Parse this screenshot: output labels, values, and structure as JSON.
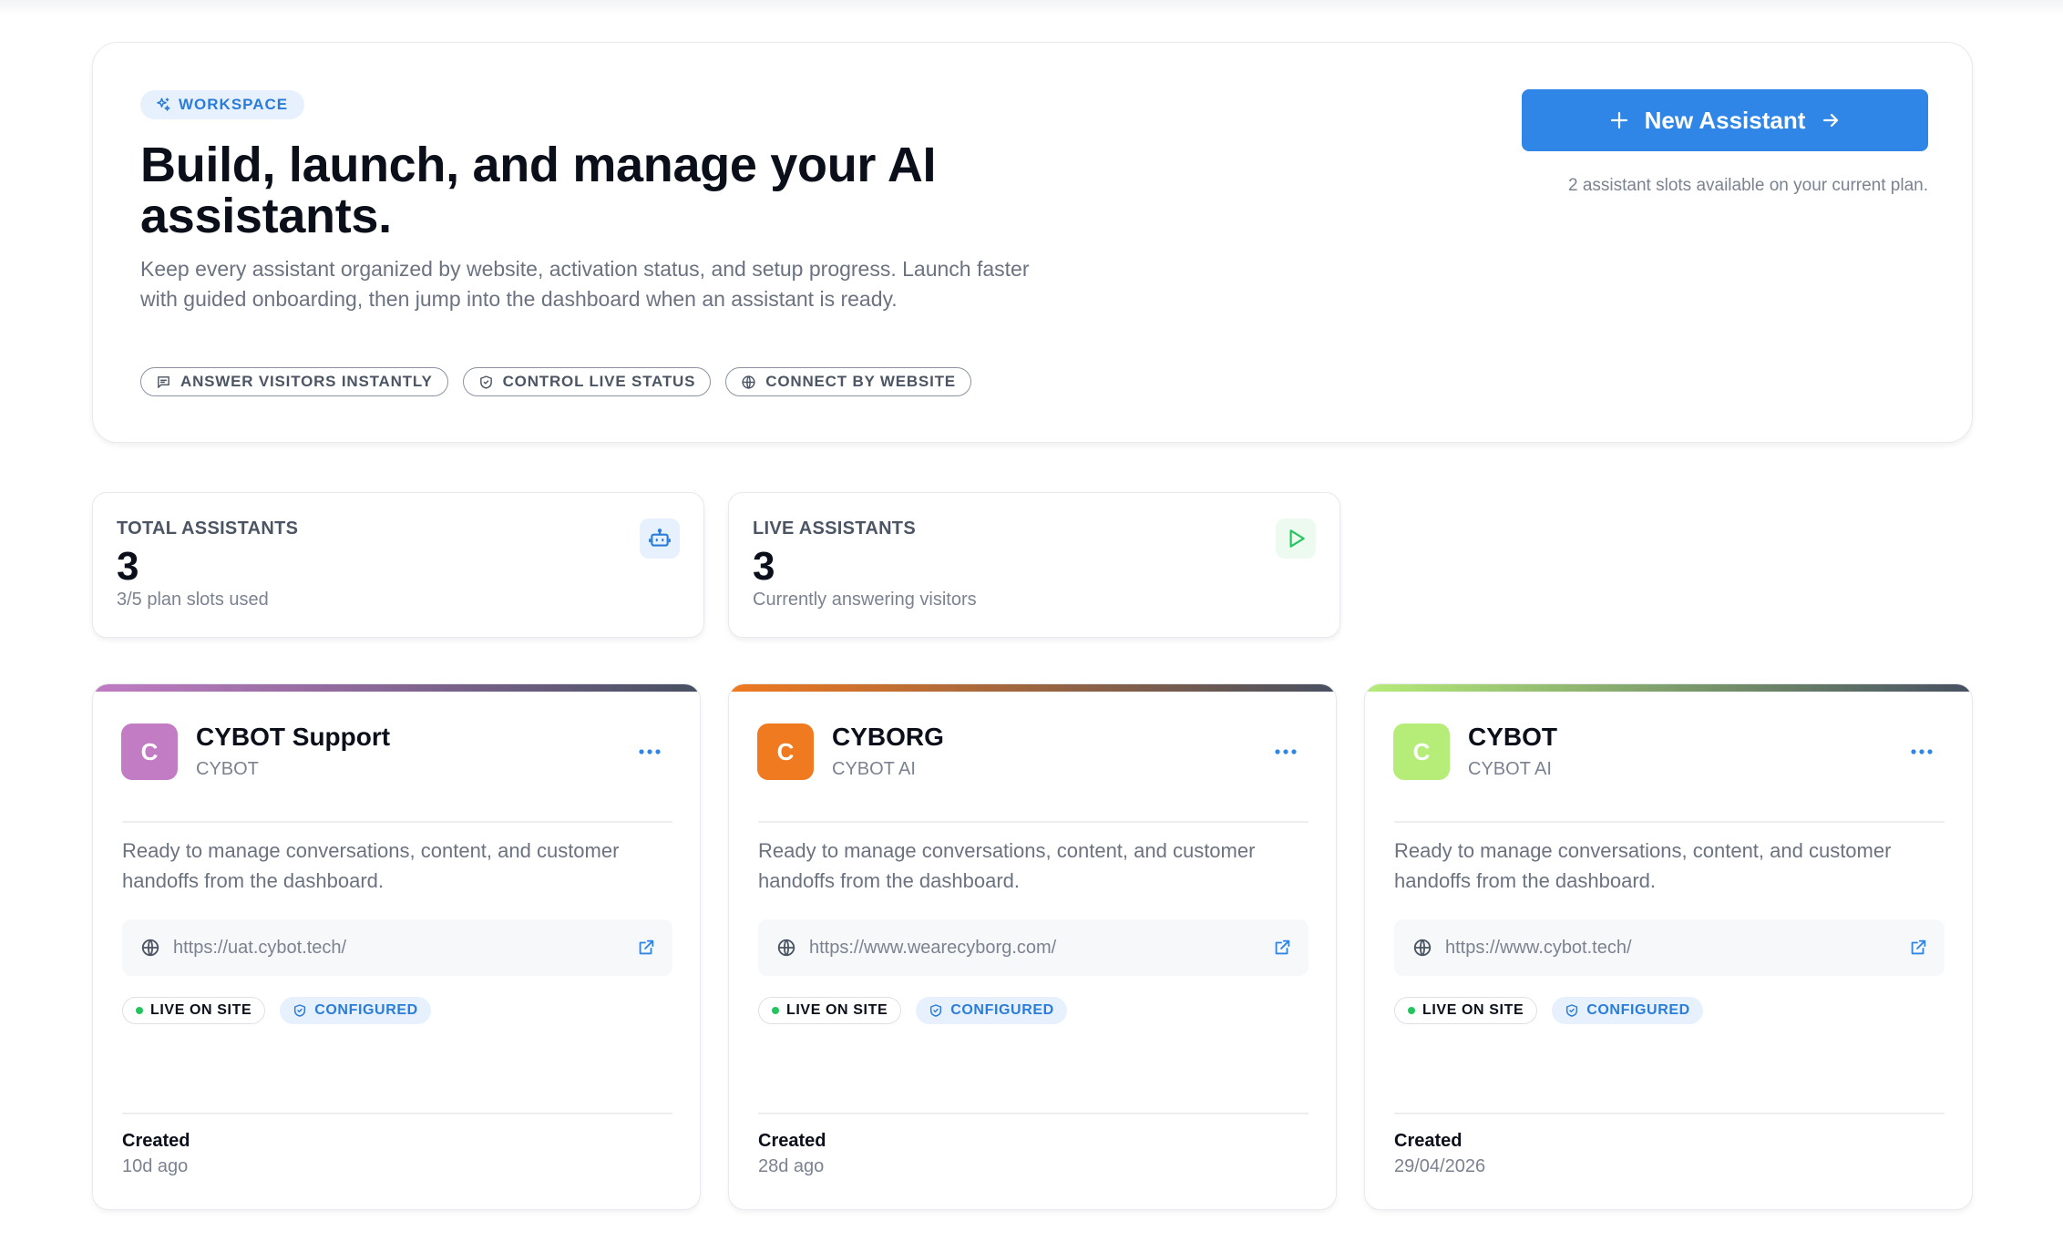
{
  "hero": {
    "badge": "WORKSPACE",
    "title": "Build, launch, and manage your AI assistants.",
    "description": "Keep every assistant organized by website, activation status, and setup progress. Launch faster with guided onboarding, then jump into the dashboard when an assistant is ready.",
    "features": [
      {
        "label": "ANSWER VISITORS INSTANTLY",
        "icon": "message-icon"
      },
      {
        "label": "CONTROL LIVE STATUS",
        "icon": "shield-icon"
      },
      {
        "label": "CONNECT BY WEBSITE",
        "icon": "globe-icon"
      }
    ],
    "new_button_label": "New Assistant",
    "slots_note": "2 assistant slots available on your current plan."
  },
  "stats": {
    "total": {
      "label": "TOTAL ASSISTANTS",
      "value": "3",
      "sub": "3/5 plan slots used",
      "icon": "robot-icon"
    },
    "live": {
      "label": "LIVE ASSISTANTS",
      "value": "3",
      "sub": "Currently answering visitors",
      "icon": "play-icon"
    }
  },
  "assistants": [
    {
      "initial": "C",
      "name": "CYBOT Support",
      "org": "CYBOT",
      "description": "Ready to manage conversations, content, and customer handoffs from the dashboard.",
      "url": "https://uat.cybot.tech/",
      "live_label": "LIVE ON SITE",
      "configured_label": "CONFIGURED",
      "created_label": "Created",
      "created_value": "10d ago",
      "avatar_color": "#c17cc4",
      "bar_gradient": [
        "#c17cc4",
        "#475061"
      ]
    },
    {
      "initial": "C",
      "name": "CYBORG",
      "org": "CYBOT AI",
      "description": "Ready to manage conversations, content, and customer handoffs from the dashboard.",
      "url": "https://www.wearecyborg.com/",
      "live_label": "LIVE ON SITE",
      "configured_label": "CONFIGURED",
      "created_label": "Created",
      "created_value": "28d ago",
      "avatar_color": "#f07a20",
      "bar_gradient": [
        "#f07a20",
        "#475061"
      ]
    },
    {
      "initial": "C",
      "name": "CYBOT",
      "org": "CYBOT AI",
      "description": "Ready to manage conversations, content, and customer handoffs from the dashboard.",
      "url": "https://www.cybot.tech/",
      "live_label": "LIVE ON SITE",
      "configured_label": "CONFIGURED",
      "created_label": "Created",
      "created_value": "29/04/2026",
      "avatar_color": "#b6ec78",
      "bar_gradient": [
        "#b6ec78",
        "#475061"
      ]
    }
  ],
  "colors": {
    "accent": "#2f86e6",
    "badge_bg": "#e6f1fd",
    "live_green": "#22c55e"
  }
}
